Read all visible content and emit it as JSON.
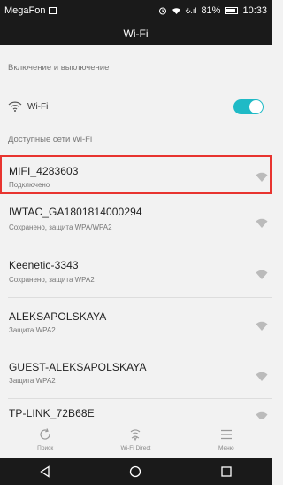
{
  "status_bar": {
    "carrier": "MegaFon",
    "signal_text": "₺.ıl",
    "battery_percent": "81%",
    "time": "10:33"
  },
  "title": "Wi-Fi",
  "toggle_section": {
    "header": "Включение и выключение",
    "wifi_label": "Wi-Fi",
    "wifi_on": true
  },
  "networks_section": {
    "header": "Доступные сети Wi-Fi",
    "networks": [
      {
        "name": "MIFI_4283603",
        "status": "Подключено",
        "selected": true
      },
      {
        "name": "IWTAC_GA1801814000294",
        "status": "Сохранено, защита WPA/WPA2",
        "selected": false
      },
      {
        "name": "Keenetic-3343",
        "status": "Сохранено, защита WPA2",
        "selected": false
      },
      {
        "name": "ALEKSAPOLSKAYA",
        "status": "Защита WPA2",
        "selected": false
      },
      {
        "name": "GUEST-ALEKSAPOLSKAYA",
        "status": "Защита WPA2",
        "selected": false
      },
      {
        "name": "TP-LINK_72B68E",
        "status": "",
        "selected": false
      }
    ]
  },
  "bottom_bar": {
    "search": "Поиск",
    "wifi_direct": "Wi-Fi Direct",
    "menu": "Меню"
  },
  "colors": {
    "accent": "#1fbac6",
    "selection": "#e8342f",
    "bar": "#1a1a1a"
  }
}
